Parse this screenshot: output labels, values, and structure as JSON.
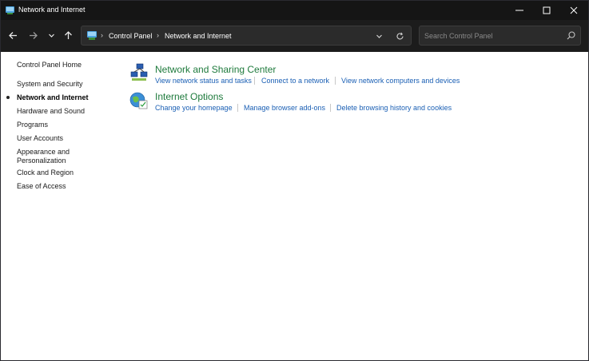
{
  "window": {
    "title": "Network and Internet"
  },
  "address_bar": {
    "crumbs": [
      "Control Panel",
      "Network and Internet"
    ]
  },
  "search": {
    "placeholder": "Search Control Panel"
  },
  "sidebar": {
    "items": [
      {
        "label": "Control Panel Home"
      },
      {
        "label": "System and Security"
      },
      {
        "label": "Network and Internet",
        "active": true
      },
      {
        "label": "Hardware and Sound"
      },
      {
        "label": "Programs"
      },
      {
        "label": "User Accounts"
      },
      {
        "label": "Appearance and"
      },
      {
        "label": "Personalization"
      },
      {
        "label": "Clock and Region"
      },
      {
        "label": "Ease of Access"
      }
    ]
  },
  "categories": [
    {
      "title": "Network and Sharing Center",
      "tasks": [
        "View network status and tasks",
        "Connect to a network",
        "View network computers and devices"
      ]
    },
    {
      "title": "Internet Options",
      "tasks": [
        "Change your homepage",
        "Manage browser add-ons",
        "Delete browsing history and cookies"
      ]
    }
  ],
  "colors": {
    "category_title": "#1e7a3c",
    "task_link": "#1a5fb4",
    "titlebar": "#151515"
  }
}
